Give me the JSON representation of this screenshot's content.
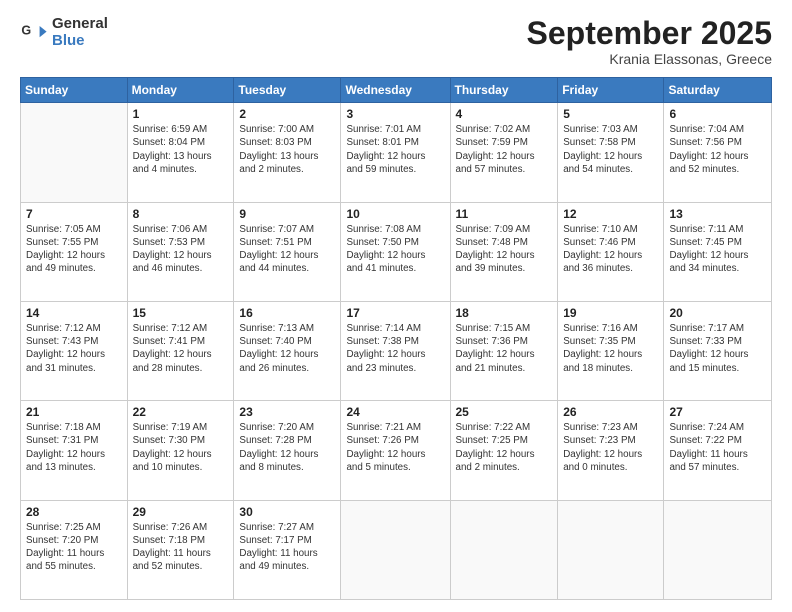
{
  "logo": {
    "general": "General",
    "blue": "Blue"
  },
  "header": {
    "month": "September 2025",
    "location": "Krania Elassonas, Greece"
  },
  "weekdays": [
    "Sunday",
    "Monday",
    "Tuesday",
    "Wednesday",
    "Thursday",
    "Friday",
    "Saturday"
  ],
  "weeks": [
    [
      {
        "date": "",
        "info": ""
      },
      {
        "date": "1",
        "info": "Sunrise: 6:59 AM\nSunset: 8:04 PM\nDaylight: 13 hours\nand 4 minutes."
      },
      {
        "date": "2",
        "info": "Sunrise: 7:00 AM\nSunset: 8:03 PM\nDaylight: 13 hours\nand 2 minutes."
      },
      {
        "date": "3",
        "info": "Sunrise: 7:01 AM\nSunset: 8:01 PM\nDaylight: 12 hours\nand 59 minutes."
      },
      {
        "date": "4",
        "info": "Sunrise: 7:02 AM\nSunset: 7:59 PM\nDaylight: 12 hours\nand 57 minutes."
      },
      {
        "date": "5",
        "info": "Sunrise: 7:03 AM\nSunset: 7:58 PM\nDaylight: 12 hours\nand 54 minutes."
      },
      {
        "date": "6",
        "info": "Sunrise: 7:04 AM\nSunset: 7:56 PM\nDaylight: 12 hours\nand 52 minutes."
      }
    ],
    [
      {
        "date": "7",
        "info": "Sunrise: 7:05 AM\nSunset: 7:55 PM\nDaylight: 12 hours\nand 49 minutes."
      },
      {
        "date": "8",
        "info": "Sunrise: 7:06 AM\nSunset: 7:53 PM\nDaylight: 12 hours\nand 46 minutes."
      },
      {
        "date": "9",
        "info": "Sunrise: 7:07 AM\nSunset: 7:51 PM\nDaylight: 12 hours\nand 44 minutes."
      },
      {
        "date": "10",
        "info": "Sunrise: 7:08 AM\nSunset: 7:50 PM\nDaylight: 12 hours\nand 41 minutes."
      },
      {
        "date": "11",
        "info": "Sunrise: 7:09 AM\nSunset: 7:48 PM\nDaylight: 12 hours\nand 39 minutes."
      },
      {
        "date": "12",
        "info": "Sunrise: 7:10 AM\nSunset: 7:46 PM\nDaylight: 12 hours\nand 36 minutes."
      },
      {
        "date": "13",
        "info": "Sunrise: 7:11 AM\nSunset: 7:45 PM\nDaylight: 12 hours\nand 34 minutes."
      }
    ],
    [
      {
        "date": "14",
        "info": "Sunrise: 7:12 AM\nSunset: 7:43 PM\nDaylight: 12 hours\nand 31 minutes."
      },
      {
        "date": "15",
        "info": "Sunrise: 7:12 AM\nSunset: 7:41 PM\nDaylight: 12 hours\nand 28 minutes."
      },
      {
        "date": "16",
        "info": "Sunrise: 7:13 AM\nSunset: 7:40 PM\nDaylight: 12 hours\nand 26 minutes."
      },
      {
        "date": "17",
        "info": "Sunrise: 7:14 AM\nSunset: 7:38 PM\nDaylight: 12 hours\nand 23 minutes."
      },
      {
        "date": "18",
        "info": "Sunrise: 7:15 AM\nSunset: 7:36 PM\nDaylight: 12 hours\nand 21 minutes."
      },
      {
        "date": "19",
        "info": "Sunrise: 7:16 AM\nSunset: 7:35 PM\nDaylight: 12 hours\nand 18 minutes."
      },
      {
        "date": "20",
        "info": "Sunrise: 7:17 AM\nSunset: 7:33 PM\nDaylight: 12 hours\nand 15 minutes."
      }
    ],
    [
      {
        "date": "21",
        "info": "Sunrise: 7:18 AM\nSunset: 7:31 PM\nDaylight: 12 hours\nand 13 minutes."
      },
      {
        "date": "22",
        "info": "Sunrise: 7:19 AM\nSunset: 7:30 PM\nDaylight: 12 hours\nand 10 minutes."
      },
      {
        "date": "23",
        "info": "Sunrise: 7:20 AM\nSunset: 7:28 PM\nDaylight: 12 hours\nand 8 minutes."
      },
      {
        "date": "24",
        "info": "Sunrise: 7:21 AM\nSunset: 7:26 PM\nDaylight: 12 hours\nand 5 minutes."
      },
      {
        "date": "25",
        "info": "Sunrise: 7:22 AM\nSunset: 7:25 PM\nDaylight: 12 hours\nand 2 minutes."
      },
      {
        "date": "26",
        "info": "Sunrise: 7:23 AM\nSunset: 7:23 PM\nDaylight: 12 hours\nand 0 minutes."
      },
      {
        "date": "27",
        "info": "Sunrise: 7:24 AM\nSunset: 7:22 PM\nDaylight: 11 hours\nand 57 minutes."
      }
    ],
    [
      {
        "date": "28",
        "info": "Sunrise: 7:25 AM\nSunset: 7:20 PM\nDaylight: 11 hours\nand 55 minutes."
      },
      {
        "date": "29",
        "info": "Sunrise: 7:26 AM\nSunset: 7:18 PM\nDaylight: 11 hours\nand 52 minutes."
      },
      {
        "date": "30",
        "info": "Sunrise: 7:27 AM\nSunset: 7:17 PM\nDaylight: 11 hours\nand 49 minutes."
      },
      {
        "date": "",
        "info": ""
      },
      {
        "date": "",
        "info": ""
      },
      {
        "date": "",
        "info": ""
      },
      {
        "date": "",
        "info": ""
      }
    ]
  ]
}
